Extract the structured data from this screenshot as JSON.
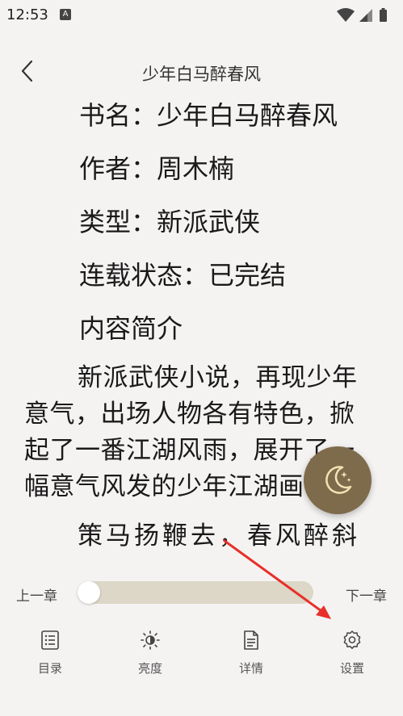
{
  "status": {
    "time": "12:53",
    "notification_glyph": "A",
    "icons": [
      "wifi-icon",
      "signal-icon",
      "battery-icon"
    ]
  },
  "header": {
    "title": "少年白马醉春风",
    "back_icon": "chevron-left-icon"
  },
  "book": {
    "title_line": "书名：少年白马醉春风",
    "author_line": "作者：周木楠",
    "type_line": "类型：新派武侠",
    "status_line": "连载状态：已完结",
    "intro_heading": "内容简介",
    "paragraph1": "新派武侠小说，再现少年意气，出场人物各有特色，掀起了一番江湖风雨，展开了一幅意气风发的少年江湖画卷。",
    "paragraph2": "策马扬鞭去，春风醉斜"
  },
  "night_mode": {
    "icon": "moon-icon"
  },
  "progress": {
    "prev_label": "上一章",
    "next_label": "下一章",
    "value": 0
  },
  "bottom_nav": {
    "items": [
      {
        "label": "目录",
        "icon": "list-icon"
      },
      {
        "label": "亮度",
        "icon": "brightness-icon"
      },
      {
        "label": "详情",
        "icon": "document-icon"
      },
      {
        "label": "设置",
        "icon": "gear-icon"
      }
    ]
  },
  "colors": {
    "background": "#f5f3f2",
    "accent": "#7e6b4c",
    "track": "#dcd7c6",
    "annotation_arrow": "#e8302a"
  }
}
